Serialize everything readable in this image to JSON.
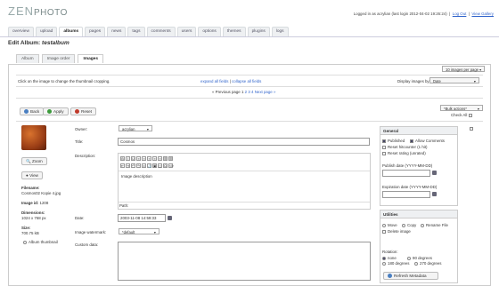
{
  "app": {
    "logo_main": "ZEN",
    "logo_sub": "PHOTO"
  },
  "user": {
    "text": "Logged in as acrylian (last login 2012-04-02 19:26:24)",
    "logout": "Log Out",
    "view_gallery": "View Gallery",
    "sep": "|"
  },
  "nav": [
    "overview",
    "upload",
    "albums",
    "pages",
    "news",
    "tags",
    "comments",
    "users",
    "options",
    "themes",
    "plugins",
    "logs"
  ],
  "page": {
    "title_prefix": "Edit Album: ",
    "title_album": "testalbum"
  },
  "subtabs": [
    "Album",
    "Image order",
    "Images"
  ],
  "top": {
    "per_page": "10 images per page",
    "instruction": "Click on the image to change the thumbnail cropping.",
    "expand": "expand all fields",
    "collapse": "collapse all fields",
    "field_sep": "|",
    "display_by_label": "Display images by:",
    "display_by": "Date",
    "prev": "« Previous page",
    "pages": [
      "1",
      "2",
      "3",
      "4"
    ],
    "next": "Next page »"
  },
  "actions": {
    "back": "Back",
    "apply": "Apply",
    "reset": "Reset",
    "bulk": "*Bulk actions*",
    "check_all": "Check All"
  },
  "image": {
    "zoom": "Zoom",
    "view": "View",
    "filename_label": "Filename:",
    "filename": "Cosmos02 Kopie 4.jpg",
    "id_label": "Image id:",
    "id": "1208",
    "dim_label": "Dimensions:",
    "dim": "1024 x 768 px",
    "size_label": "Size:",
    "size": "700.75 kB",
    "album_thumb": "Album thumbnail"
  },
  "form": {
    "owner_label": "Owner:",
    "owner": "acrylian",
    "title_label": "Title:",
    "title": "Cosmos",
    "desc_label": "Description:",
    "desc": "Image description",
    "path": "Path:",
    "date_label": "Date:",
    "date": "2003-11-08 14:59:33",
    "watermark_label": "Image watermark:",
    "watermark": "*default",
    "custom_label": "Custom data:",
    "toolbar_glyphs": [
      "B",
      "I",
      "U",
      "≡",
      "≡",
      "≡",
      "≡",
      "≡",
      "☰",
      "☰",
      "⇤",
      "⇥",
      "↶",
      "↷",
      "∞",
      "⚓",
      "▣",
      "◻",
      "Ω",
      "</>"
    ]
  },
  "general": {
    "title": "General",
    "published": "Published",
    "allow_comments": "Allow Comments",
    "reset_hit": "Reset hitcounter (1 hit)",
    "reset_rating": "Reset rating (unrated)",
    "publish_date": "Publish date (YYYY-MM-DD)",
    "expiration_date": "Expiration date (YYYY-MM-DD)"
  },
  "utilities": {
    "title": "Utilities",
    "move": "Move",
    "copy": "Copy",
    "rename": "Rename File",
    "delete": "Delete image",
    "rotation_label": "Rotation:",
    "none": "none",
    "r90": "90 degrees",
    "r180": "180 degrees",
    "r270": "270 degrees",
    "refresh": "Refresh Metadata"
  },
  "colors": {
    "accent_link": "#3366cc",
    "back_icon": "#4a7fc1",
    "apply_icon": "#3c9a3c",
    "reset_icon": "#c03a2b"
  }
}
